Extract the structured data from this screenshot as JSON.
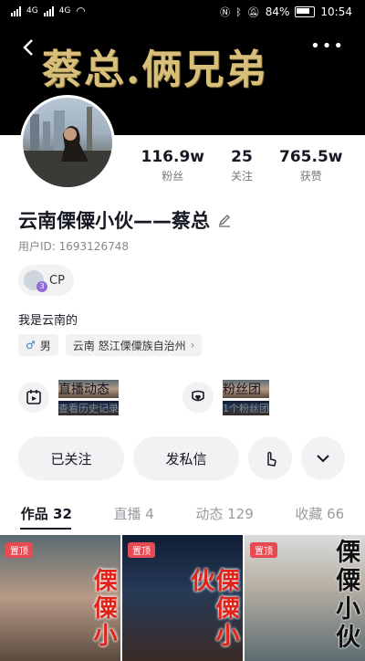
{
  "status_bar": {
    "network_left": "4G",
    "network_right": "4G",
    "battery": "84%",
    "time": "10:54"
  },
  "header": {
    "banner_text": "蔡总.俩兄弟",
    "back_icon": "chevron-left-icon",
    "more_icon": "more-dots-icon"
  },
  "profile": {
    "stats": [
      {
        "value": "116.9w",
        "label": "粉丝"
      },
      {
        "value": "25",
        "label": "关注"
      },
      {
        "value": "765.5w",
        "label": "获赞"
      }
    ],
    "name": "云南傈僳小伙——蔡总",
    "user_id": "用户ID: 1693126748",
    "cp_label": "CP",
    "bio": "我是云南的",
    "tags": [
      {
        "icon": "male-icon",
        "text": "男"
      },
      {
        "text": "云南 怒江傈僳族自治州"
      }
    ]
  },
  "features": [
    {
      "title": "直播动态",
      "subtitle": "查看历史记录",
      "icon": "live-calendar-icon"
    },
    {
      "title": "粉丝团",
      "subtitle": "1个粉丝团",
      "icon": "fan-club-heart-icon"
    }
  ],
  "actions": {
    "follow_label": "已关注",
    "message_label": "发私信"
  },
  "tabs": [
    {
      "label": "作品 32",
      "active": true
    },
    {
      "label": "直播 4",
      "active": false
    },
    {
      "label": "动态 129",
      "active": false
    },
    {
      "label": "收藏 66",
      "active": false
    }
  ],
  "videos": [
    {
      "pinned": "置顶",
      "caption": "傈僳小",
      "caption_color": "#e2231a"
    },
    {
      "pinned": "置顶",
      "caption": "傈僳小伙",
      "caption_color": "#e2231a"
    },
    {
      "pinned": "置顶",
      "caption": "傈僳小伙",
      "caption_color": "#111111"
    }
  ]
}
